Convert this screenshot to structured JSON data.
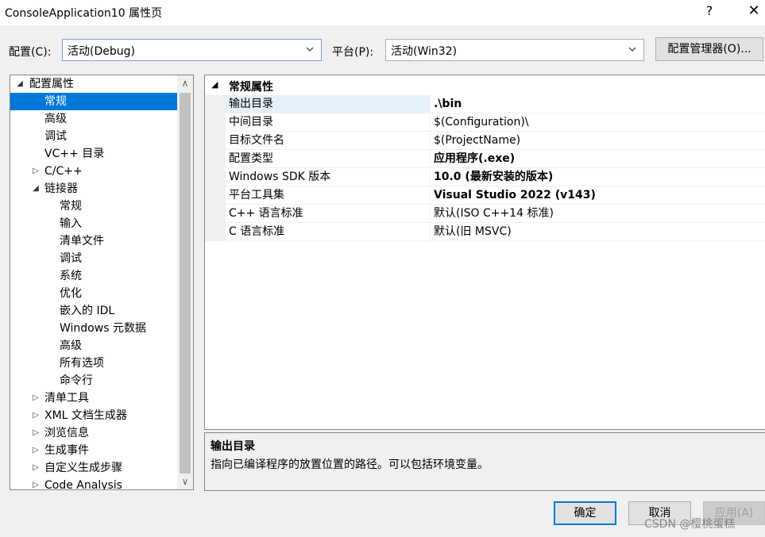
{
  "window": {
    "title": "ConsoleApplication10 属性页",
    "help": "?",
    "close": "✕"
  },
  "toolbar": {
    "config_label": "配置(C):",
    "config_value": "活动(Debug)",
    "platform_label": "平台(P):",
    "platform_value": "活动(Win32)",
    "config_manager": "配置管理器(O)..."
  },
  "tree": {
    "items": [
      {
        "label": "配置属性",
        "expander": "◢"
      },
      {
        "label": "常规",
        "expander": ""
      },
      {
        "label": "高级",
        "expander": ""
      },
      {
        "label": "调试",
        "expander": ""
      },
      {
        "label": "VC++ 目录",
        "expander": ""
      },
      {
        "label": "C/C++",
        "expander": "▷"
      },
      {
        "label": "链接器",
        "expander": "◢"
      },
      {
        "label": "常规",
        "expander": ""
      },
      {
        "label": "输入",
        "expander": ""
      },
      {
        "label": "清单文件",
        "expander": ""
      },
      {
        "label": "调试",
        "expander": ""
      },
      {
        "label": "系统",
        "expander": ""
      },
      {
        "label": "优化",
        "expander": ""
      },
      {
        "label": "嵌入的 IDL",
        "expander": ""
      },
      {
        "label": "Windows 元数据",
        "expander": ""
      },
      {
        "label": "高级",
        "expander": ""
      },
      {
        "label": "所有选项",
        "expander": ""
      },
      {
        "label": "命令行",
        "expander": ""
      },
      {
        "label": "清单工具",
        "expander": "▷"
      },
      {
        "label": "XML 文档生成器",
        "expander": "▷"
      },
      {
        "label": "浏览信息",
        "expander": "▷"
      },
      {
        "label": "生成事件",
        "expander": "▷"
      },
      {
        "label": "自定义生成步骤",
        "expander": "▷"
      },
      {
        "label": "Code Analysis",
        "expander": "▷"
      }
    ]
  },
  "grid": {
    "category": "常规属性",
    "category_expander": "◢",
    "rows": [
      {
        "name": "输出目录",
        "value": ".\\bin"
      },
      {
        "name": "中间目录",
        "value": "$(Configuration)\\"
      },
      {
        "name": "目标文件名",
        "value": "$(ProjectName)"
      },
      {
        "name": "配置类型",
        "value": "应用程序(.exe)"
      },
      {
        "name": "Windows SDK 版本",
        "value": "10.0 (最新安装的版本)"
      },
      {
        "name": "平台工具集",
        "value": "Visual Studio 2022 (v143)"
      },
      {
        "name": "C++ 语言标准",
        "value": "默认(ISO C++14 标准)"
      },
      {
        "name": "C 语言标准",
        "value": "默认(旧 MSVC)"
      }
    ]
  },
  "description": {
    "title": "输出目录",
    "text": "指向已编译程序的放置位置的路径。可以包括环境变量。"
  },
  "buttons": {
    "ok": "确定",
    "cancel": "取消",
    "apply": "应用(A)"
  },
  "watermark": "CSDN @樱桃蛋糕"
}
